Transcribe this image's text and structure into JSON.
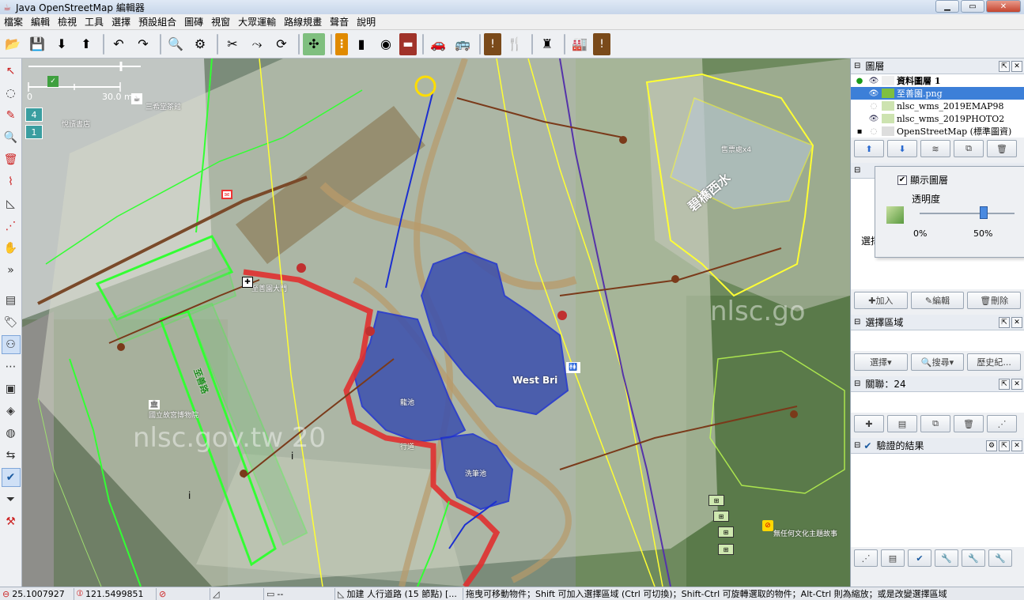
{
  "window": {
    "title": "Java OpenStreetMap 編輯器",
    "controls": [
      "minimize",
      "maximize",
      "close"
    ]
  },
  "menu": [
    "檔案",
    "編輯",
    "檢視",
    "工具",
    "選擇",
    "預設組合",
    "圖磚",
    "視窗",
    "大眾運輸",
    "路線規畫",
    "聲音",
    "說明"
  ],
  "toolbar": {
    "icons": [
      "open-file-icon",
      "save-icon",
      "download-icon",
      "upload-icon",
      "undo-icon",
      "redo-icon",
      "zoom-icon",
      "preferences-icon",
      "split-way-icon",
      "combine-way-icon",
      "refresh-icon",
      "image-offset-icon",
      "crossing-icon",
      "traffic-light-icon",
      "wall-icon",
      "car-icon",
      "bus-icon",
      "warning-icon",
      "restaurant-icon",
      "castle-icon",
      "factory-icon",
      "alert-icon"
    ]
  },
  "left_tools": [
    "select-tool-icon",
    "lasso-icon",
    "draw-icon",
    "zoom-tool-icon",
    "delete-icon",
    "draw-path-icon",
    "measure-icon",
    "node-icon",
    "hand-icon",
    "more-icon",
    "layers-toggle-icon",
    "tag-icon",
    "relation-icon",
    "filter-icon",
    "validator-icon",
    "check-icon",
    "funnel-icon",
    "toolbox-icon"
  ],
  "map": {
    "scale": {
      "start": "0",
      "end": "30.0 m"
    },
    "layer_badges": [
      "4",
      "1"
    ],
    "labels": {
      "sanxi_pavilion": "三希堂茶館",
      "bookstore": "悅讀書店",
      "library_entrance": "至善園大門",
      "long_pond": "龍池",
      "brush_pond": "洗筆池",
      "bigi_west_water": "碧橋西水",
      "museum": "國立故宮博物院",
      "green_road": "至善路",
      "walkway": "行道",
      "west_bridge": "West Bri",
      "ticket_x4": "售票處x4",
      "notice": "無任何文化主題故事"
    },
    "watermarks": [
      "nlsc",
      "nlsc.gov.tw 20",
      "nlsc.go"
    ]
  },
  "layers_panel": {
    "title": "圖層",
    "rows": [
      {
        "name": "資料圖層 1",
        "active": true,
        "visible": true,
        "selected": false,
        "bold": true
      },
      {
        "name": "至善園.png",
        "active": false,
        "visible": true,
        "selected": true,
        "bold": false
      },
      {
        "name": "nlsc_wms_2019EMAP98",
        "active": false,
        "visible": false,
        "selected": false,
        "bold": false
      },
      {
        "name": "nlsc_wms_2019PHOTO2",
        "active": false,
        "visible": true,
        "selected": false,
        "bold": false
      },
      {
        "name": "OpenStreetMap (標準圖資)",
        "active": false,
        "visible": false,
        "selected": false,
        "bold": false
      }
    ],
    "buttons": [
      "move-up-icon",
      "move-down-icon",
      "merge-layers-icon",
      "duplicate-icon",
      "delete-layer-icon"
    ]
  },
  "opacity_popup": {
    "show_layer_label": "顯示圖層",
    "show_layer_checked": true,
    "opacity_label": "透明度",
    "opacity_value": 0.5,
    "tick_min": "0%",
    "tick_mid": "50%"
  },
  "side_clip_label": "選擇",
  "props_panel": {
    "add_label": "加入",
    "edit_label": "編輯",
    "delete_label": "刪除"
  },
  "selection_panel": {
    "title": "選擇區域",
    "select_label": "選擇",
    "search_label": "搜尋",
    "history_label": "歷史紀..."
  },
  "relations_panel": {
    "title": "關聯：24"
  },
  "validation_panel": {
    "title": "驗證的結果"
  },
  "status": {
    "lat": "25.1007927",
    "lon": "121.5499851",
    "heading": "",
    "angle": "",
    "length": "--",
    "way_info": "加建 人行道路 (15 節點) [...",
    "hint": "拖曳可移動物件；Shift 可加入選擇區域 (Ctrl 可切換)；Shift-Ctrl 可旋轉選取的物件；Alt-Ctrl 則為縮放；或是改變選擇區域"
  },
  "colors": {
    "pond_fill": "#3b4fae",
    "path_red": "#e03030",
    "way_green": "#33ff33",
    "way_yellow": "#ffff33",
    "accent_blue": "#3c7fd8"
  }
}
